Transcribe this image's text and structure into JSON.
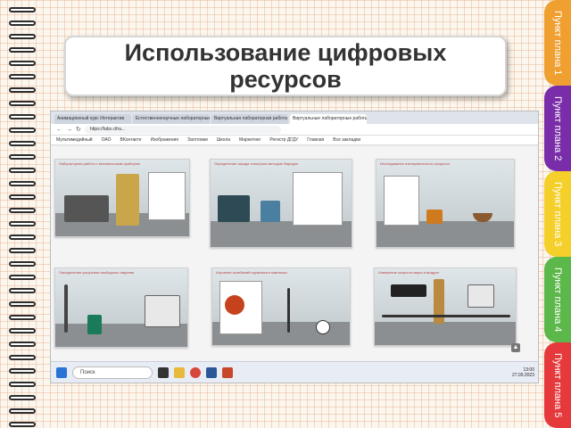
{
  "title": "Использование цифровых ресурсов",
  "tabs": [
    {
      "label": "Пункт плана 1",
      "color": "#f0a030"
    },
    {
      "label": "Пункт плана 2",
      "color": "#7a2da8"
    },
    {
      "label": "Пункт плана 3",
      "color": "#f5d02a"
    },
    {
      "label": "Пункт плана 4",
      "color": "#5cb84a"
    },
    {
      "label": "Пункт плана 5",
      "color": "#e5393c"
    }
  ],
  "browser": {
    "tabs": [
      "Анимационный курс Интерактив",
      "Естественнонаучные лабораторные работы",
      "Виртуальная лабораторная работа",
      "Виртуальные лабораторные работы"
    ],
    "url": "https://labs.cifra...",
    "bookmarks": [
      "Мультимедийный",
      "ОАО",
      "ВКонтакте",
      "Изображения",
      "Заготовки",
      "Школа",
      "Маркетинг",
      "Регистр ДГДУ",
      "Главная",
      "Все закладки"
    ],
    "lab_captions": [
      "Лабораторная работа с механическим прибором",
      "Определение заряда электрона методом Фарадея",
      "Исследование изотермического процесса",
      "Определение ускорения свободного падения",
      "Изучение колебаний пружинного маятника",
      "Измерение скорости звука в воздухе"
    ],
    "search_placeholder": "Поиск",
    "clock_time": "13:00",
    "clock_date": "27.09.2023"
  }
}
